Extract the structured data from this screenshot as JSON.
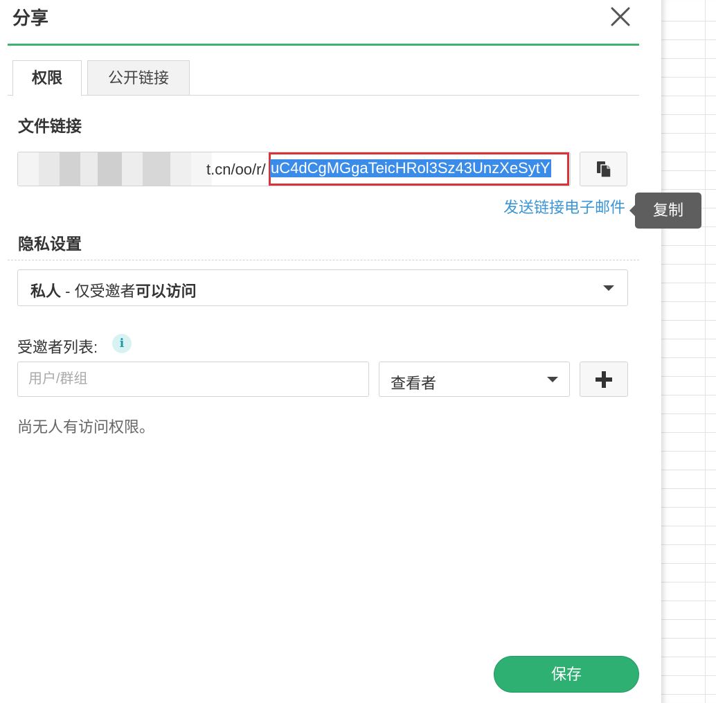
{
  "dialog": {
    "title": "分享",
    "tabs": [
      {
        "label": "权限",
        "active": true
      },
      {
        "label": "公开链接",
        "active": false
      }
    ]
  },
  "file_link": {
    "section_label": "文件链接",
    "url_visible_prefix": "t.cn/oo/r/",
    "url_selected_part": "uC4dCgMGgaTeicHRol3Sz43UnzXeSytY",
    "copy_icon": "copy-icon",
    "email_link_label": "发送链接电子邮件",
    "copy_tooltip": "复制"
  },
  "privacy": {
    "section_label": "隐私设置",
    "selected_option": {
      "part1": "私人",
      "part2": " - 仅受邀者",
      "part3": "可以访问"
    }
  },
  "invitees": {
    "label": "受邀者列表:",
    "info_icon": "info-icon",
    "input_placeholder": "用户/群组",
    "role_selected": "查看者",
    "add_icon": "plus-icon",
    "empty_message": "尚无人有访问权限。"
  },
  "footer": {
    "save_label": "保存"
  },
  "colors": {
    "accent_green": "#2eb072",
    "link_blue": "#3a96d6",
    "selection_blue": "#3b8ce8",
    "highlight_red": "#d9343a"
  }
}
